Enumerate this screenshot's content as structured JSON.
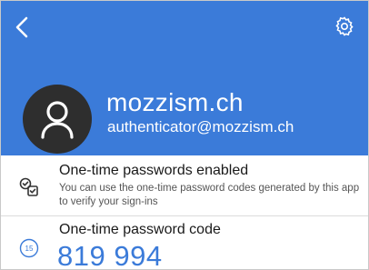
{
  "header": {
    "back_icon": "chevron-left-icon",
    "settings_icon": "gear-icon",
    "accent_color": "#3B7BD9"
  },
  "account": {
    "name": "mozzism.ch",
    "email": "authenticator@mozzism.ch",
    "avatar_icon": "person-icon"
  },
  "otp_enabled": {
    "icon": "checklist-icon",
    "title": "One-time passwords enabled",
    "description": "You can use the one-time password codes generated by this app to verify your sign-ins"
  },
  "otp_code": {
    "icon": "timer-icon",
    "timer_seconds": "15",
    "title": "One-time password code",
    "code": "819 994"
  }
}
